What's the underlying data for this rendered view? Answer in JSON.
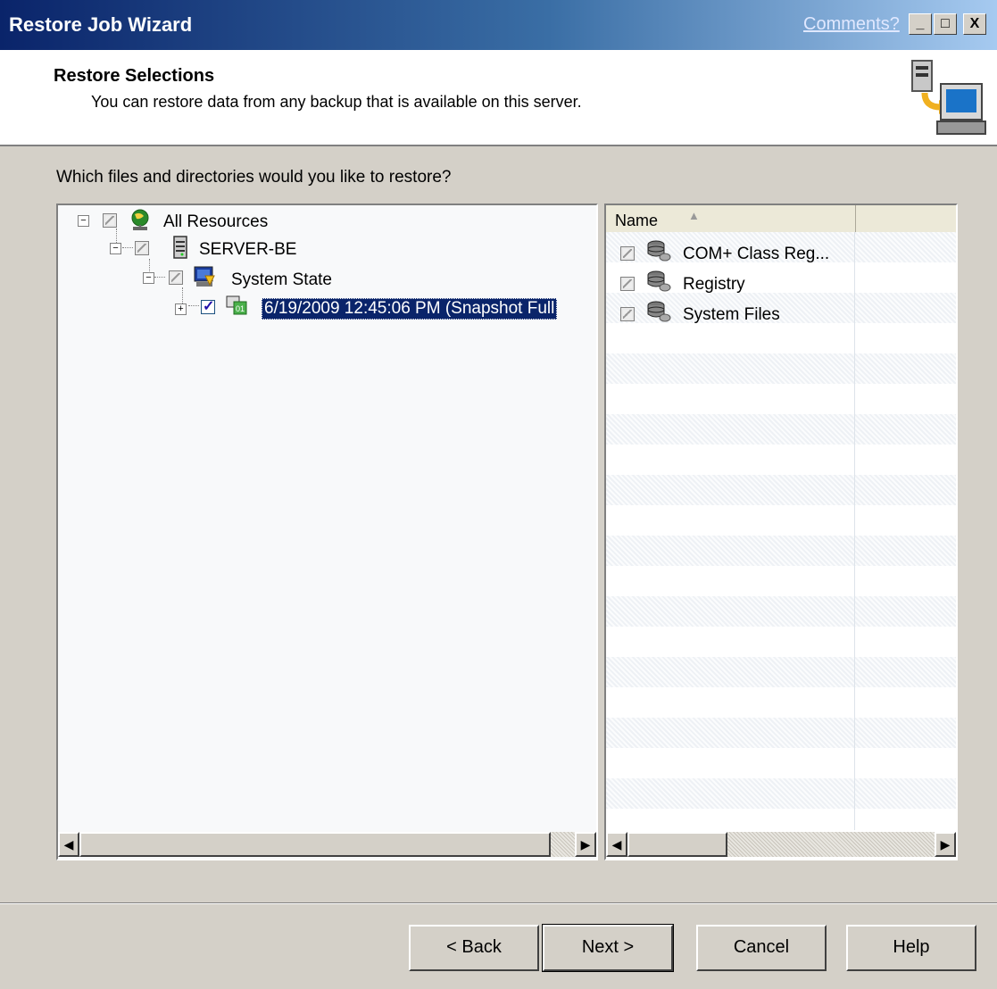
{
  "window": {
    "title": "Restore Job Wizard",
    "comments_link": "Comments?",
    "controls": {
      "minimize": "_",
      "maximize": "□",
      "close": "X"
    }
  },
  "header": {
    "title": "Restore Selections",
    "subtitle": "You can restore data from any backup that is available on this server.",
    "icon": "restore-computer-icon"
  },
  "main": {
    "question": "Which files and directories would you like to restore?",
    "tree": [
      {
        "label": "All Resources",
        "icon": "globe-icon",
        "check": "partial",
        "expander": "−"
      },
      {
        "label": "SERVER-BE",
        "icon": "server-icon",
        "check": "partial",
        "expander": "−"
      },
      {
        "label": "System State",
        "icon": "system-state-icon",
        "check": "partial",
        "expander": "−"
      },
      {
        "label": "6/19/2009 12:45:06 PM (Snapshot Full",
        "icon": "backup-set-icon",
        "check": "checked",
        "expander": "+",
        "selected": true
      }
    ],
    "list": {
      "columns": [
        "Name",
        ""
      ],
      "sort_indicator": "▲",
      "items": [
        {
          "label": "COM+ Class Reg...",
          "icon": "database-icon",
          "check": "partial"
        },
        {
          "label": "Registry",
          "icon": "database-icon",
          "check": "partial"
        },
        {
          "label": "System Files",
          "icon": "database-icon",
          "check": "partial"
        }
      ]
    }
  },
  "footer": {
    "back": "< Back",
    "next": "Next >",
    "cancel": "Cancel",
    "help": "Help"
  },
  "colors": {
    "title_bar": "#0a246a",
    "selection": "#0a246a",
    "face": "#d4d0c8"
  }
}
